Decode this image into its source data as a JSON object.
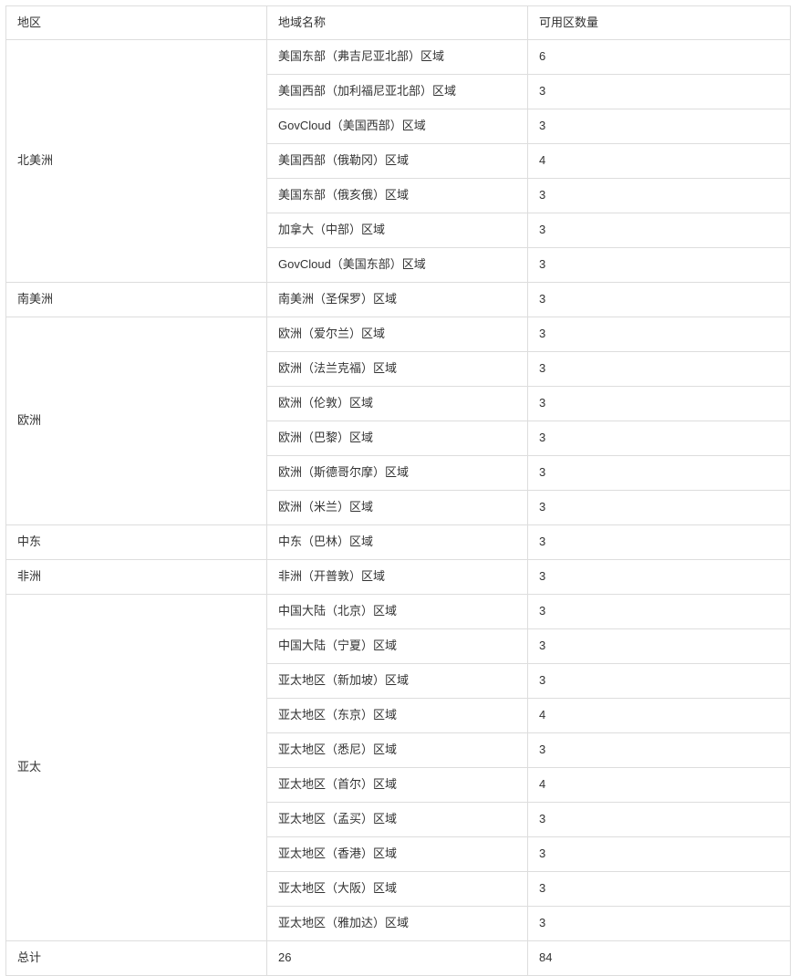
{
  "table": {
    "columns": [
      {
        "key": "region",
        "label": "地区"
      },
      {
        "key": "name",
        "label": "地域名称"
      },
      {
        "key": "azcount",
        "label": "可用区数量"
      }
    ],
    "groups": [
      {
        "region": "北美洲",
        "rows": [
          {
            "name": "美国东部（弗吉尼亚北部）区域",
            "azcount": "6"
          },
          {
            "name": "美国西部（加利福尼亚北部）区域",
            "azcount": "3"
          },
          {
            "name": "GovCloud（美国西部）区域",
            "azcount": "3"
          },
          {
            "name": "美国西部（俄勒冈）区域",
            "azcount": "4"
          },
          {
            "name": "美国东部（俄亥俄）区域",
            "azcount": "3"
          },
          {
            "name": "加拿大（中部）区域",
            "azcount": "3"
          },
          {
            "name": "GovCloud（美国东部）区域",
            "azcount": "3"
          }
        ]
      },
      {
        "region": "南美洲",
        "rows": [
          {
            "name": "南美洲（圣保罗）区域",
            "azcount": "3"
          }
        ]
      },
      {
        "region": "欧洲",
        "rows": [
          {
            "name": "欧洲（爱尔兰）区域",
            "azcount": "3"
          },
          {
            "name": "欧洲（法兰克福）区域",
            "azcount": "3"
          },
          {
            "name": "欧洲（伦敦）区域",
            "azcount": "3"
          },
          {
            "name": "欧洲（巴黎）区域",
            "azcount": "3"
          },
          {
            "name": "欧洲（斯德哥尔摩）区域",
            "azcount": "3"
          },
          {
            "name": "欧洲（米兰）区域",
            "azcount": "3"
          }
        ]
      },
      {
        "region": "中东",
        "rows": [
          {
            "name": "中东（巴林）区域",
            "azcount": "3"
          }
        ]
      },
      {
        "region": "非洲",
        "rows": [
          {
            "name": "非洲（开普敦）区域",
            "azcount": "3"
          }
        ]
      },
      {
        "region": "亚太",
        "rows": [
          {
            "name": "中国大陆（北京）区域",
            "azcount": "3"
          },
          {
            "name": "中国大陆（宁夏）区域",
            "azcount": "3"
          },
          {
            "name": "亚太地区（新加坡）区域",
            "azcount": "3"
          },
          {
            "name": "亚太地区（东京）区域",
            "azcount": "4"
          },
          {
            "name": "亚太地区（悉尼）区域",
            "azcount": "3"
          },
          {
            "name": "亚太地区（首尔）区域",
            "azcount": "4"
          },
          {
            "name": "亚太地区（孟买）区域",
            "azcount": "3"
          },
          {
            "name": "亚太地区（香港）区域",
            "azcount": "3"
          },
          {
            "name": "亚太地区（大阪）区域",
            "azcount": "3"
          },
          {
            "name": "亚太地区（雅加达）区域",
            "azcount": "3"
          }
        ]
      }
    ],
    "total_row": {
      "region": "总计",
      "name": "26",
      "azcount": "84"
    }
  },
  "colors": {
    "border": "#dddddd",
    "text": "#333333",
    "background": "#ffffff"
  }
}
